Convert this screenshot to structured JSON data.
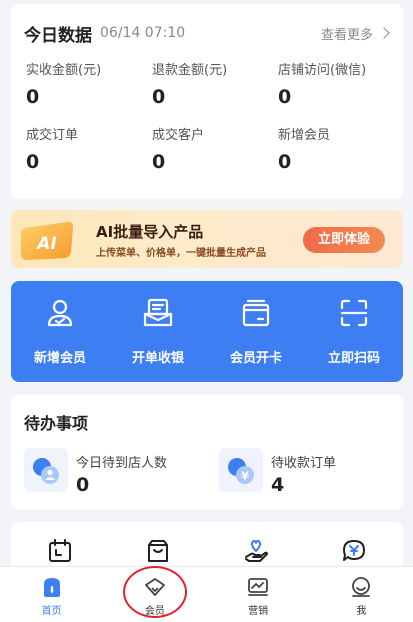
{
  "today": {
    "title": "今日数据",
    "time": "06/14 07:10",
    "more": "查看更多",
    "stats": [
      {
        "label": "实收金额(元)",
        "value": "0"
      },
      {
        "label": "退款金额(元)",
        "value": "0"
      },
      {
        "label": "店铺访问(微信)",
        "value": "0"
      },
      {
        "label": "成交订单",
        "value": "0"
      },
      {
        "label": "成交客户",
        "value": "0"
      },
      {
        "label": "新增会员",
        "value": "0"
      }
    ]
  },
  "ai_banner": {
    "logo": "AI",
    "title": "AI批量导入产品",
    "subtitle": "上传菜单、价格单，一键批量生成产品",
    "button": "立即体验"
  },
  "quick_actions": [
    {
      "label": "新增会员",
      "icon": "add-member-icon"
    },
    {
      "label": "开单收银",
      "icon": "cashier-icon"
    },
    {
      "label": "会员开卡",
      "icon": "card-icon"
    },
    {
      "label": "立即扫码",
      "icon": "scan-icon"
    }
  ],
  "todo": {
    "title": "待办事项",
    "items": [
      {
        "label": "今日待到店人数",
        "value": "0",
        "icon": "visitor-icon"
      },
      {
        "label": "待收款订单",
        "value": "4",
        "icon": "payment-icon"
      }
    ]
  },
  "tools": [
    {
      "icon": "calendar-icon"
    },
    {
      "icon": "bag-icon"
    },
    {
      "icon": "heart-hand-icon"
    },
    {
      "icon": "yen-chat-icon"
    }
  ],
  "bottom_nav": [
    {
      "label": "首页",
      "icon": "home-icon",
      "active": true
    },
    {
      "label": "会员",
      "icon": "diamond-icon",
      "active": false
    },
    {
      "label": "营销",
      "icon": "marketing-icon",
      "active": false
    },
    {
      "label": "我",
      "icon": "profile-icon",
      "active": false
    }
  ],
  "colors": {
    "accent": "#3d7ef2",
    "banner_button": "#f06b4b",
    "highlight": "#e0242b"
  }
}
